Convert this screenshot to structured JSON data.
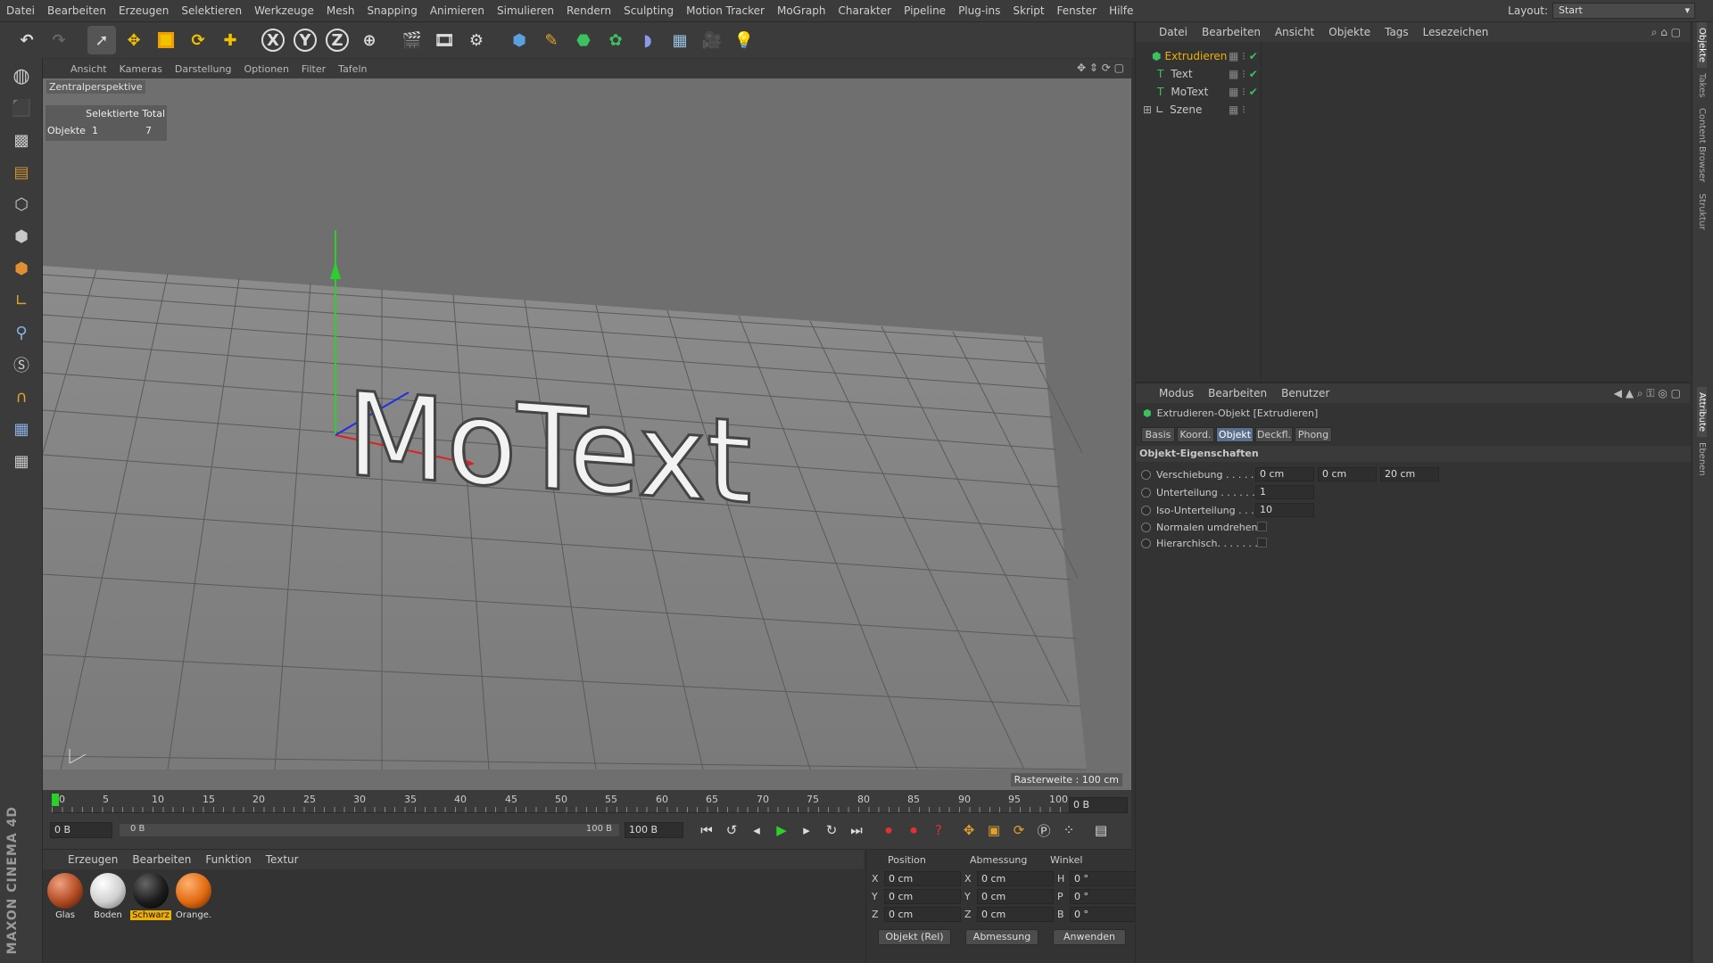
{
  "menubar": {
    "items": [
      "Datei",
      "Bearbeiten",
      "Erzeugen",
      "Selektieren",
      "Werkzeuge",
      "Mesh",
      "Snapping",
      "Animieren",
      "Simulieren",
      "Rendern",
      "Sculpting",
      "Motion Tracker",
      "MoGraph",
      "Charakter",
      "Pipeline",
      "Plug-ins",
      "Skript",
      "Fenster",
      "Hilfe"
    ],
    "layout_label": "Layout:",
    "layout_value": "Start"
  },
  "toolbar": {
    "icons": [
      "undo-icon",
      "redo-icon",
      "select-arrow-icon",
      "move-icon",
      "scale-icon",
      "rotate-icon",
      "last-tool-icon",
      "x-axis-icon",
      "y-axis-icon",
      "z-axis-icon",
      "coordinate-system-icon",
      "render-view-icon",
      "render-picture-viewer-icon",
      "render-settings-icon",
      "cube-primitive-icon",
      "spline-pen-icon",
      "subdivision-icon",
      "mograph-cloner-icon",
      "deformer-icon",
      "floor-environment-icon",
      "camera-icon",
      "light-icon"
    ],
    "axis_labels": [
      "X",
      "Y",
      "Z"
    ]
  },
  "left_tools": [
    "model-mode-icon",
    "object-mode-icon",
    "texture-mode-icon",
    "workplane-icon",
    "points-mode-icon",
    "edges-mode-icon",
    "polygons-mode-icon",
    "axis-mode-icon",
    "tweak-icon",
    "snap-icon",
    "magnet-icon",
    "workplane-lock-icon",
    "solo-icon"
  ],
  "brand": "MAXON CINEMA 4D",
  "viewport": {
    "menu": [
      "Ansicht",
      "Kameras",
      "Darstellung",
      "Optionen",
      "Filter",
      "Tafeln"
    ],
    "camera": "Zentralperspektive",
    "stats_header": "Selektierte Total",
    "stats_row_label": "Objekte",
    "stats_selected": "1",
    "stats_total": "7",
    "text3d": "MoText",
    "grid_info": "Rasterweite : 100 cm"
  },
  "timeline": {
    "ticks": [
      "0",
      "5",
      "10",
      "15",
      "20",
      "25",
      "30",
      "35",
      "40",
      "45",
      "50",
      "55",
      "60",
      "65",
      "70",
      "75",
      "80",
      "85",
      "90",
      "95",
      "100"
    ],
    "current_frame_field": "0 B",
    "start_field": "0 B",
    "range_left": "0 B",
    "range_right": "100 B",
    "end_field": "100 B",
    "right_field": "0 B"
  },
  "materials": {
    "menu": [
      "Erzeugen",
      "Bearbeiten",
      "Funktion",
      "Textur"
    ],
    "items": [
      {
        "name": "Glas",
        "color": "#b04a22"
      },
      {
        "name": "Boden",
        "color": "#d8d8d8"
      },
      {
        "name": "Schwarz",
        "color": "#1c1c1c"
      },
      {
        "name": "Orange.",
        "color": "#e06a10"
      }
    ]
  },
  "coordinates": {
    "headers": [
      "Position",
      "Abmessung",
      "Winkel"
    ],
    "rows": [
      {
        "axis": "X",
        "pos": "0 cm",
        "size_axis": "X",
        "size": "0 cm",
        "ang_axis": "H",
        "ang": "0 °"
      },
      {
        "axis": "Y",
        "pos": "0 cm",
        "size_axis": "Y",
        "size": "0 cm",
        "ang_axis": "P",
        "ang": "0 °"
      },
      {
        "axis": "Z",
        "pos": "0 cm",
        "size_axis": "Z",
        "size": "0 cm",
        "ang_axis": "B",
        "ang": "0 °"
      }
    ],
    "mode_select": "Objekt (Rel)",
    "size_select": "Abmessung",
    "apply_button": "Anwenden"
  },
  "object_manager": {
    "menu": [
      "Datei",
      "Bearbeiten",
      "Ansicht",
      "Objekte",
      "Tags",
      "Lesezeichen"
    ],
    "objects": [
      {
        "name": "Extrudieren",
        "selected": true
      },
      {
        "name": "Text",
        "selected": false
      },
      {
        "name": "MoText",
        "selected": false
      },
      {
        "name": "Szene",
        "selected": false
      }
    ]
  },
  "attribute_manager": {
    "menu": [
      "Modus",
      "Bearbeiten",
      "Benutzer"
    ],
    "object_title": "Extrudieren-Objekt [Extrudieren]",
    "tabs": [
      "Basis",
      "Koord.",
      "Objekt",
      "Deckfl.",
      "Phong"
    ],
    "active_tab": "Objekt",
    "section": "Objekt-Eigenschaften",
    "props": {
      "offset_label": "Verschiebung . . . . .",
      "offset_x": "0 cm",
      "offset_y": "0 cm",
      "offset_z": "20 cm",
      "subdiv_label": "Unterteilung . . . . . .",
      "subdiv": "1",
      "iso_label": "Iso-Unterteilung . . .",
      "iso": "10",
      "flip_label": "Normalen umdrehen",
      "hier_label": "Hierarchisch. . . . . . ."
    }
  },
  "side_tabs": [
    "Objekte",
    "Takes",
    "Content Browser",
    "Struktur",
    "Attribute",
    "Ebenen"
  ]
}
